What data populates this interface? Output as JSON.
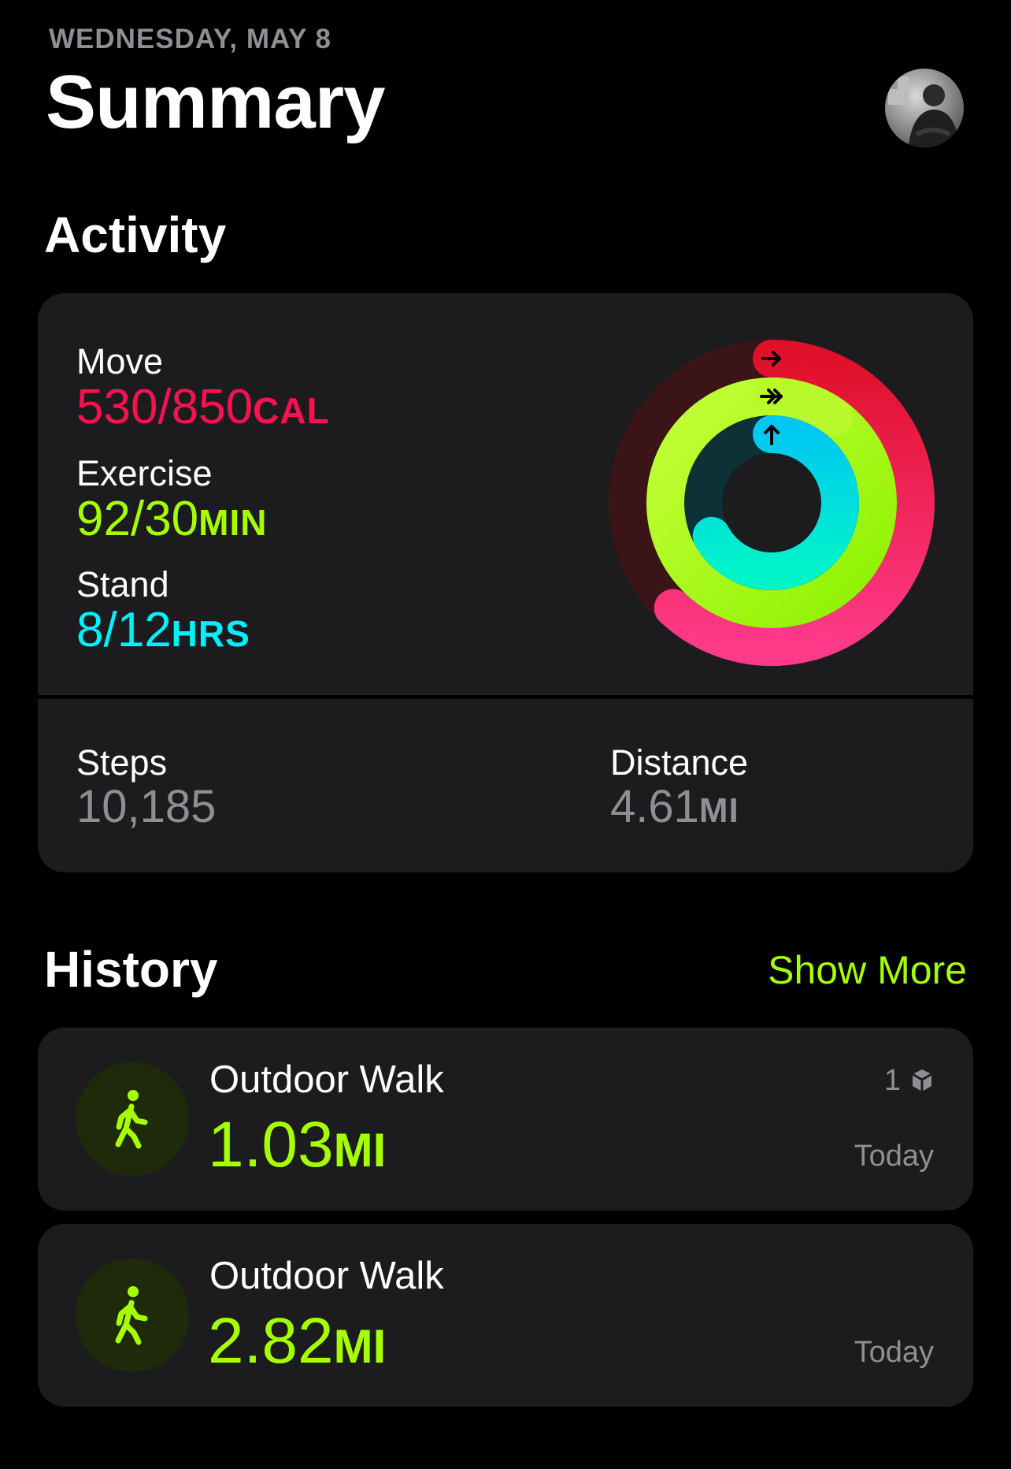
{
  "header": {
    "date": "WEDNESDAY, MAY 8",
    "title": "Summary",
    "avatar_icon": "profile-photo"
  },
  "activity": {
    "section_title": "Activity",
    "move": {
      "label": "Move",
      "value": "530/850",
      "unit": "CAL",
      "color": "#fa114f",
      "progress": 0.62
    },
    "exercise": {
      "label": "Exercise",
      "value": "92/30",
      "unit": "MIN",
      "color": "#a6ff00",
      "progress": 3.07
    },
    "stand": {
      "label": "Stand",
      "value": "8/12",
      "unit": "HRS",
      "color": "#00f0ff",
      "progress": 0.67
    },
    "steps": {
      "label": "Steps",
      "value": "10,185"
    },
    "distance": {
      "label": "Distance",
      "value": "4.61",
      "unit": "MI"
    }
  },
  "history": {
    "section_title": "History",
    "show_more_label": "Show More",
    "items": [
      {
        "name": "Outdoor Walk",
        "distance": "1.03",
        "unit": "MI",
        "count": "1",
        "count_icon": "device-icon",
        "date": "Today",
        "icon": "walking-figure-icon"
      },
      {
        "name": "Outdoor Walk",
        "distance": "2.82",
        "unit": "MI",
        "count": "",
        "date": "Today",
        "icon": "walking-figure-icon"
      }
    ]
  },
  "colors": {
    "background": "#000000",
    "card": "#1c1c1e",
    "secondary_text": "#8e8e93",
    "accent": "#a6ff00"
  }
}
